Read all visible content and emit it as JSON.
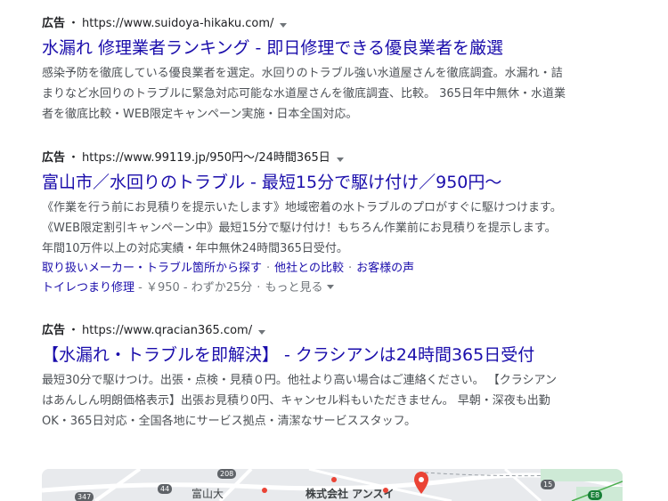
{
  "ads": [
    {
      "label": "広告",
      "url": "https://www.suidoya-hikaku.com/",
      "title": "水漏れ 修理業者ランキング - 即日修理できる優良業者を厳選",
      "description": "感染予防を徹底している優良業者を選定。水回りのトラブル強い水道屋さんを徹底調査。水漏れ・詰まりなど水回りのトラブルに緊急対応可能な水道屋さんを徹底調査、比較。 365日年中無休・水道業者を徹底比較・WEB限定キャンペーン実施・日本全国対応。"
    },
    {
      "label": "広告",
      "url": "https://www.99119.jp/950円〜/24時間365日",
      "title": "富山市／水回りのトラブル - 最短15分で駆け付け／950円〜",
      "description": "《作業を行う前にお見積りを提示いたします》地域密着の水トラブルのプロがすぐに駆けつけます。《WEB限定割引キャンペーン中》最短15分で駆け付け！もちろん作業前にお見積りを提示します。 年間10万件以上の対応実績・年中無休24時間365日受付。",
      "sitelinks": [
        "取り扱いメーカー・トラブル箇所から探す",
        "他社との比較",
        "お客様の声"
      ],
      "sub_link": "トイレつまり修理",
      "sub_price": " - ￥950 - ",
      "sub_time": "わずか25分",
      "more": "もっと見る"
    },
    {
      "label": "広告",
      "url": "https://www.qracian365.com/",
      "title": "【水漏れ・トラブルを即解決】 - クラシアンは24時間365日受付",
      "description": "最短30分で駆けつけ。出張・点検・見積０円。他社より高い場合はご連絡ください。 【クラシアンはあんしん明朗価格表示】出張お見積り0円、キャンセル料もいただきません。 早朝・深夜も出勤OK・365日対応・全国各地にサービス拠点・清潔なサービススタッフ。"
    }
  ],
  "map": {
    "labels": {
      "city": "富山大",
      "company": "株式会社 アンスイ",
      "road_208": "208",
      "road_44": "44",
      "road_347": "347",
      "road_15": "15",
      "road_e8": "E8"
    }
  },
  "colors": {
    "link": "#1a0dab",
    "text": "#4d5156",
    "pin": "#ea4335"
  }
}
